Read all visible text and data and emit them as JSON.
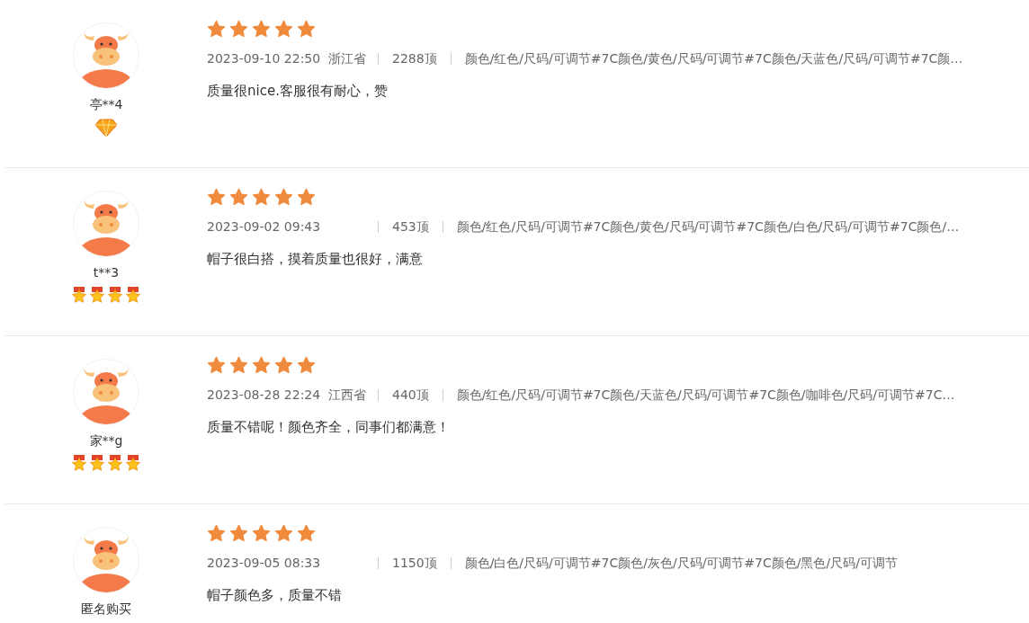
{
  "reviews": [
    {
      "user": "亭**4",
      "badge": {
        "kind": "diamond"
      },
      "rating": {
        "stars": 5
      },
      "time": "2023-09-10 22:50",
      "location": "浙江省",
      "count": "2288顶",
      "spec": "颜色/红色/尺码/可调节#7C颜色/黄色/尺码/可调节#7C颜色/天蓝色/尺码/可调节#7C颜…",
      "comment": "质量很nice.客服很有耐心，赞"
    },
    {
      "user": "t**3",
      "badge": {
        "kind": "medal",
        "stars": 4
      },
      "rating": {
        "stars": 5
      },
      "time": "2023-09-02 09:43",
      "count": "453顶",
      "spec": "颜色/红色/尺码/可调节#7C颜色/黄色/尺码/可调节#7C颜色/白色/尺码/可调节#7C颜色/…",
      "comment": "帽子很白搭，摸着质量也很好，满意"
    },
    {
      "user": "家**g",
      "badge": {
        "kind": "medal",
        "stars": 4
      },
      "rating": {
        "stars": 5
      },
      "time": "2023-08-28 22:24",
      "location": "江西省",
      "count": "440顶",
      "spec": "颜色/红色/尺码/可调节#7C颜色/天蓝色/尺码/可调节#7C颜色/咖啡色/尺码/可调节#7C…",
      "comment": "质量不错呢！颜色齐全，同事们都满意！"
    },
    {
      "user": "匿名购买",
      "rating": {
        "stars": 5
      },
      "time": "2023-09-05 08:33",
      "count": "1150顶",
      "spec": "颜色/白色/尺码/可调节#7C颜色/灰色/尺码/可调节#7C颜色/黑色/尺码/可调节",
      "comment": "帽子颜色多，质量不错"
    }
  ]
}
